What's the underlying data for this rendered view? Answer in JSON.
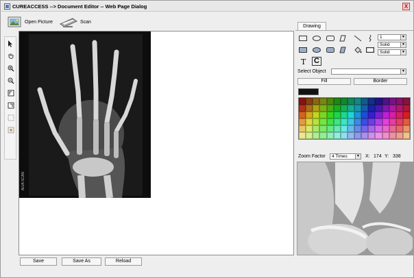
{
  "window": {
    "title": "CUREACCESS --> Document Editor -- Web Page Dialog",
    "close_label": "X"
  },
  "toolbar": {
    "open_picture_label": "Open Picture",
    "scan_label": "Scan"
  },
  "left_tools": [
    "pointer-icon",
    "hand-icon",
    "zoom-in-icon",
    "zoom-out-icon",
    "rotate-left-icon",
    "rotate-right-icon",
    "select-region-icon",
    "reset-icon"
  ],
  "xray": {
    "film_label": "ALVA SCAN"
  },
  "bottom_buttons": {
    "save": "Save",
    "save_as": "Save As",
    "reload": "Reload"
  },
  "drawing_panel": {
    "tab_label": "Drawing",
    "line_width": "1",
    "line_style_1": "Solid",
    "line_style_2": "Solid",
    "text_tool": "T",
    "clear_tool": "C",
    "select_object_label": "Select Object",
    "select_object_value": "",
    "fill_label": "Fill",
    "border_label": "Border",
    "current_color": "#111111",
    "shapes_row1": [
      "rectangle-icon",
      "ellipse-icon",
      "rounded-rect-icon",
      "polygon-icon",
      "line-icon",
      "freehand-icon"
    ],
    "shapes_row2": [
      "filled-rectangle-icon",
      "filled-ellipse-icon",
      "filled-rounded-rect-icon",
      "filled-polygon-icon",
      "paint-bucket-icon",
      "frame-icon"
    ]
  },
  "zoom": {
    "label": "Zoom Factor",
    "value": "4 Times",
    "x_label": "X:",
    "x_value": "174",
    "y_label": "Y:",
    "y_value": "338"
  }
}
